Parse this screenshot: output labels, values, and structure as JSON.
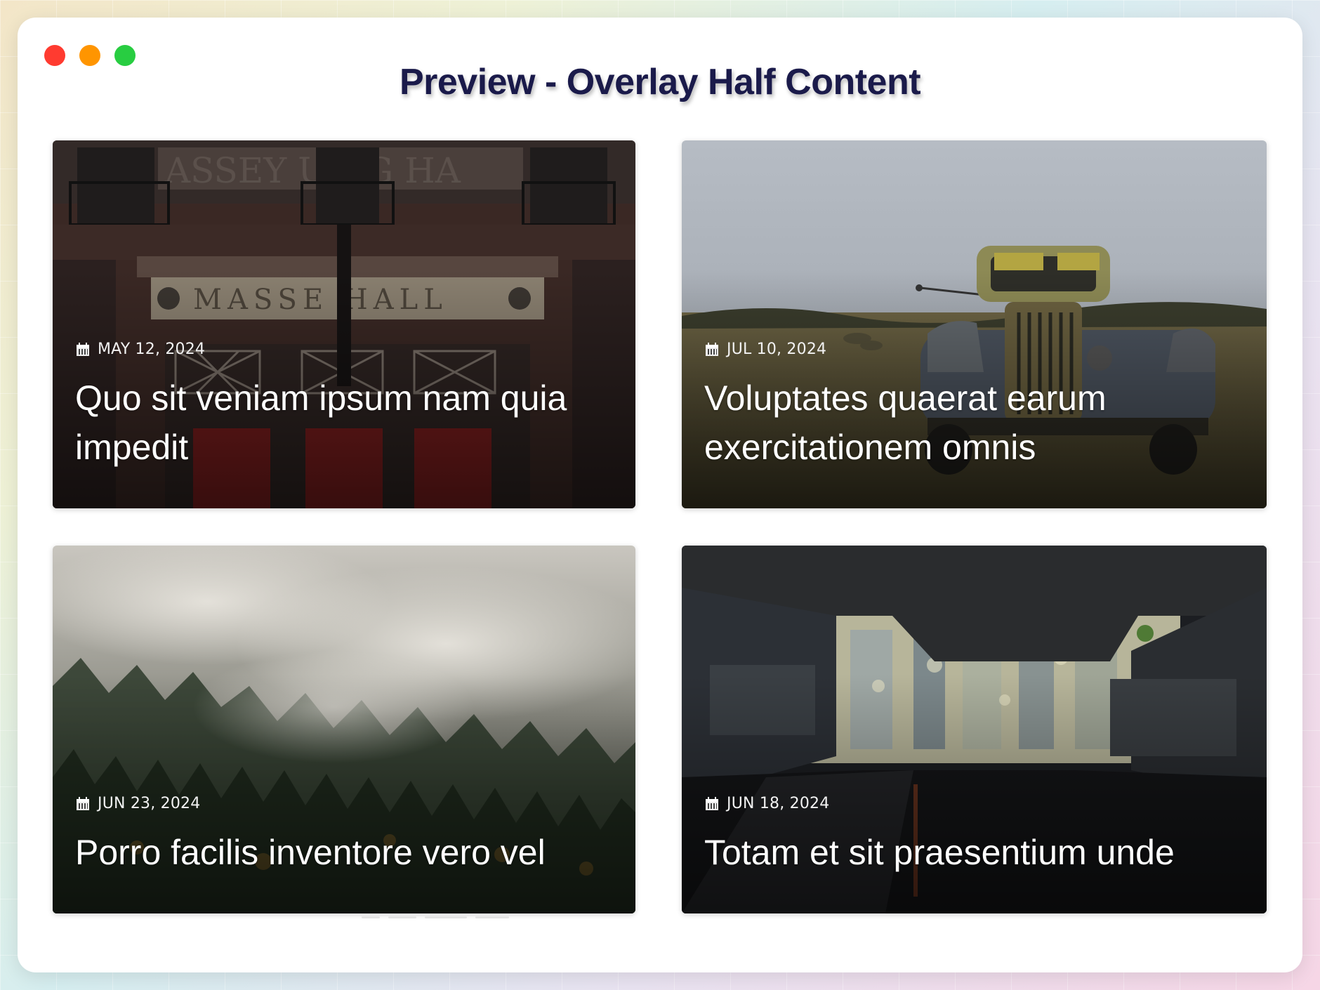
{
  "window": {
    "title": "Preview - Overlay Half Content",
    "title_color": "#1a1a4a",
    "controls": [
      {
        "name": "close",
        "color": "#ff3b30"
      },
      {
        "name": "minimize",
        "color": "#ff9500"
      },
      {
        "name": "maximize",
        "color": "#28cd41"
      }
    ]
  },
  "posts": [
    {
      "date": "MAY 12, 2024",
      "title": "Quo sit veniam ipsum nam quia impedit",
      "image": "brick-music-hall-facade"
    },
    {
      "date": "JUL 10, 2024",
      "title": "Voluptates quaerat earum exercitationem omnis",
      "image": "rusty-truck-in-field"
    },
    {
      "date": "JUN 23, 2024",
      "title": "Porro facilis inventore vero vel",
      "image": "foggy-forest"
    },
    {
      "date": "JUN 18, 2024",
      "title": "Totam et sit praesentium unde",
      "image": "city-through-vehicle-interior"
    }
  ],
  "icons": {
    "date": "calendar-icon"
  }
}
